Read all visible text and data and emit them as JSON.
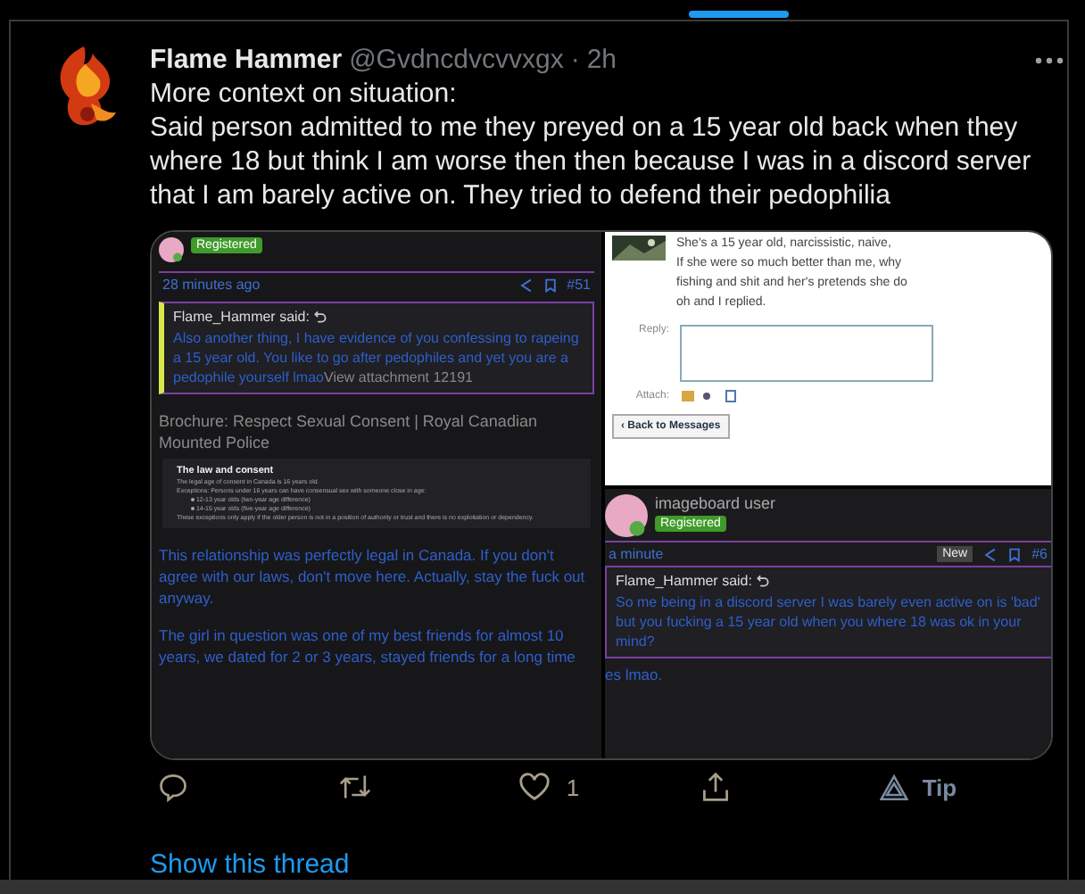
{
  "tweet": {
    "author": "Flame Hammer",
    "handle": "@Gvdncdvcvvxgx",
    "separator": "·",
    "time": "2h",
    "paragraphs": [
      "More context on situation:",
      "Said person admitted to me they preyed on a 15 year old back when they where 18 but think I am worse then then because I was in a discord server that I am barely active on.  They tried to defend their pedophilia"
    ]
  },
  "media": {
    "left": {
      "badge": "Registered",
      "time": "28 minutes ago",
      "post_number": "#51",
      "quote": {
        "author": "Flame_Hammer said:",
        "text": "Also another thing, I have evidence of you confessing to rapeing a 15 year old. You like to go after pedophiles and yet you are a pedophile yourself lmao",
        "attachment": "View attachment 12191"
      },
      "link_title": "Brochure: Respect Sexual Consent | Royal Canadian Mounted Police",
      "brochure": {
        "heading": "The law and consent",
        "lines": [
          "The legal age of consent in Canada is 16 years old.",
          "Exceptions: Persons under 16 years can have consensual sex with someone close in age:"
        ],
        "bullets": [
          "12-13 year olds (two-year age difference)",
          "14-15 year olds (five-year age difference)"
        ],
        "note": "These exceptions only apply if the older person is not in a position of authority or trust and there is no exploitation or dependency."
      },
      "paragraphs": [
        "This relationship was perfectly legal in Canada. If you don't agree with our laws, don't move here. Actually, stay the fuck out anyway.",
        "The girl in question was one of my best friends for almost 10 years, we dated for 2 or 3 years, stayed friends for a long time"
      ]
    },
    "right_top": {
      "lines": [
        "She's a 15 year old, narcissistic, naive,",
        "If she were so much better than me, why",
        "fishing and shit and her's pretends she do",
        "oh and I replied."
      ],
      "reply_label": "Reply:",
      "attach_label": "Attach:",
      "back_button": "‹ Back to Messages"
    },
    "right_bottom": {
      "username": "imageboard user",
      "badge": "Registered",
      "time": "a minute",
      "new_badge": "New",
      "post_number": "#6",
      "quote": {
        "author": "Flame_Hammer said:",
        "text": "So me being in a discord server I was barely even active on is 'bad' but you fucking a 15 year old when you where 18 was ok in your mind?"
      },
      "reply_text": "es lmao."
    }
  },
  "actions": [
    {
      "kind": "reply"
    },
    {
      "kind": "retweet"
    },
    {
      "kind": "like",
      "count": "1"
    },
    {
      "kind": "share"
    },
    {
      "kind": "tip",
      "label": "Tip"
    }
  ],
  "show_thread": "Show this thread"
}
